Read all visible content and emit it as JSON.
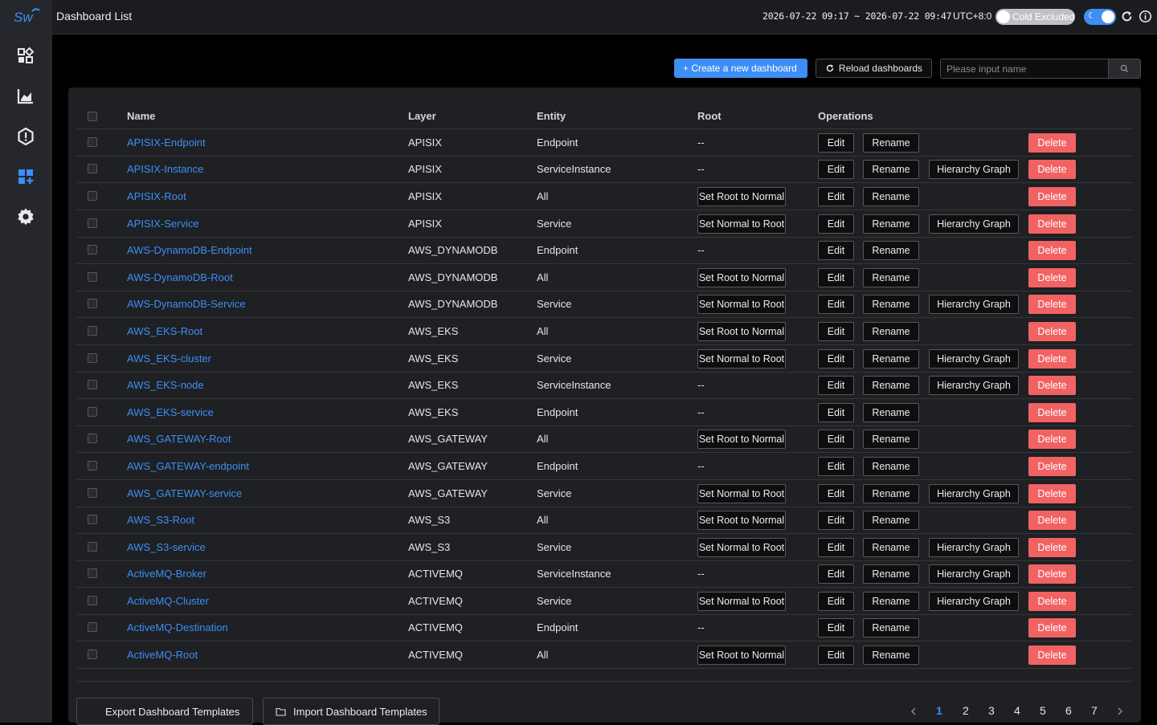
{
  "header": {
    "title": "Dashboard List",
    "time_range": "2026-07-22 09:17 ~ 2026-07-22 09:47",
    "timezone": "UTC+8:0",
    "cold_toggle_label": "Cold Excluded",
    "cold_toggle_on": false,
    "theme_toggle_on": true
  },
  "sidebar": {
    "items": [
      {
        "name": "marketplace",
        "icon": "widgets-icon"
      },
      {
        "name": "metrics",
        "icon": "chart-icon"
      },
      {
        "name": "alerting",
        "icon": "alert-hexagon-icon"
      },
      {
        "name": "dashboards",
        "icon": "dashboard-add-icon",
        "active": true
      },
      {
        "name": "settings",
        "icon": "gear-icon"
      }
    ]
  },
  "toolbar": {
    "create_label": "+ Create a new dashboard",
    "reload_label": "Reload dashboards",
    "search_placeholder": "Please input name",
    "search_value": ""
  },
  "table": {
    "headers": {
      "name": "Name",
      "layer": "Layer",
      "entity": "Entity",
      "root": "Root",
      "operations": "Operations"
    },
    "labels": {
      "edit": "Edit",
      "rename": "Rename",
      "hierarchy": "Hierarchy Graph",
      "delete": "Delete",
      "set_root_to_normal": "Set Root to Normal",
      "set_normal_to_root": "Set Normal to Root",
      "none": "--"
    },
    "rows": [
      {
        "name": "APISIX-Endpoint",
        "layer": "APISIX",
        "entity": "Endpoint",
        "root": "none",
        "hierarchy": false
      },
      {
        "name": "APISIX-Instance",
        "layer": "APISIX",
        "entity": "ServiceInstance",
        "root": "none",
        "hierarchy": true
      },
      {
        "name": "APISIX-Root",
        "layer": "APISIX",
        "entity": "All",
        "root": "set_root_to_normal",
        "hierarchy": false
      },
      {
        "name": "APISIX-Service",
        "layer": "APISIX",
        "entity": "Service",
        "root": "set_normal_to_root",
        "hierarchy": true
      },
      {
        "name": "AWS-DynamoDB-Endpoint",
        "layer": "AWS_DYNAMODB",
        "entity": "Endpoint",
        "root": "none",
        "hierarchy": false
      },
      {
        "name": "AWS-DynamoDB-Root",
        "layer": "AWS_DYNAMODB",
        "entity": "All",
        "root": "set_root_to_normal",
        "hierarchy": false
      },
      {
        "name": "AWS-DynamoDB-Service",
        "layer": "AWS_DYNAMODB",
        "entity": "Service",
        "root": "set_normal_to_root",
        "hierarchy": true
      },
      {
        "name": "AWS_EKS-Root",
        "layer": "AWS_EKS",
        "entity": "All",
        "root": "set_root_to_normal",
        "hierarchy": false
      },
      {
        "name": "AWS_EKS-cluster",
        "layer": "AWS_EKS",
        "entity": "Service",
        "root": "set_normal_to_root",
        "hierarchy": true
      },
      {
        "name": "AWS_EKS-node",
        "layer": "AWS_EKS",
        "entity": "ServiceInstance",
        "root": "none",
        "hierarchy": true
      },
      {
        "name": "AWS_EKS-service",
        "layer": "AWS_EKS",
        "entity": "Endpoint",
        "root": "none",
        "hierarchy": false
      },
      {
        "name": "AWS_GATEWAY-Root",
        "layer": "AWS_GATEWAY",
        "entity": "All",
        "root": "set_root_to_normal",
        "hierarchy": false
      },
      {
        "name": "AWS_GATEWAY-endpoint",
        "layer": "AWS_GATEWAY",
        "entity": "Endpoint",
        "root": "none",
        "hierarchy": false
      },
      {
        "name": "AWS_GATEWAY-service",
        "layer": "AWS_GATEWAY",
        "entity": "Service",
        "root": "set_normal_to_root",
        "hierarchy": true
      },
      {
        "name": "AWS_S3-Root",
        "layer": "AWS_S3",
        "entity": "All",
        "root": "set_root_to_normal",
        "hierarchy": false
      },
      {
        "name": "AWS_S3-service",
        "layer": "AWS_S3",
        "entity": "Service",
        "root": "set_normal_to_root",
        "hierarchy": true
      },
      {
        "name": "ActiveMQ-Broker",
        "layer": "ACTIVEMQ",
        "entity": "ServiceInstance",
        "root": "none",
        "hierarchy": true
      },
      {
        "name": "ActiveMQ-Cluster",
        "layer": "ACTIVEMQ",
        "entity": "Service",
        "root": "set_normal_to_root",
        "hierarchy": true
      },
      {
        "name": "ActiveMQ-Destination",
        "layer": "ACTIVEMQ",
        "entity": "Endpoint",
        "root": "none",
        "hierarchy": false
      },
      {
        "name": "ActiveMQ-Root",
        "layer": "ACTIVEMQ",
        "entity": "All",
        "root": "set_root_to_normal",
        "hierarchy": false
      }
    ]
  },
  "footer": {
    "export_label": "Export Dashboard Templates",
    "import_label": "Import Dashboard Templates"
  },
  "pagination": {
    "pages": [
      "1",
      "2",
      "3",
      "4",
      "5",
      "6",
      "7"
    ],
    "current": "1"
  },
  "colors": {
    "accent": "#3d8ef5",
    "danger": "#f16263",
    "sidebar_bg": "#25272c",
    "panel_bg": "#1f2023"
  }
}
